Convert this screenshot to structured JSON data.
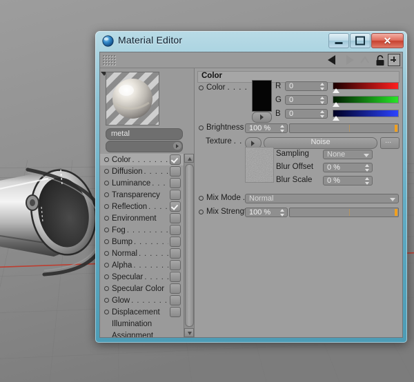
{
  "window": {
    "title": "Material Editor",
    "icon": "sphere-icon",
    "controls": {
      "minimize": "minimize-button",
      "maximize": "maximize-button",
      "close": "✕"
    }
  },
  "toolbar": {
    "grip": "drag-grip",
    "back": "back-arrow",
    "forward": "forward-arrow",
    "lock": "lock-icon",
    "add": "+"
  },
  "material": {
    "preview_label": "material-preview",
    "name": "metal",
    "selector_value": ""
  },
  "channels": [
    {
      "label": "Color",
      "dots": ". . . . . . . .",
      "checked": true,
      "selected": true
    },
    {
      "label": "Diffusion",
      "dots": ". . . . .",
      "checked": false,
      "selected": false
    },
    {
      "label": "Luminance",
      "dots": ". . .",
      "checked": false,
      "selected": false
    },
    {
      "label": "Transparency",
      "dots": "",
      "checked": false,
      "selected": false
    },
    {
      "label": "Reflection",
      "dots": ". . . .",
      "checked": true,
      "selected": false
    },
    {
      "label": "Environment",
      "dots": "",
      "checked": false,
      "selected": false
    },
    {
      "label": "Fog",
      "dots": ". . . . . . . .",
      "checked": false,
      "selected": false
    },
    {
      "label": "Bump",
      "dots": ". . . . . . .",
      "checked": false,
      "selected": false
    },
    {
      "label": "Normal",
      "dots": ". . . . . .",
      "checked": false,
      "selected": false
    },
    {
      "label": "Alpha",
      "dots": ". . . . . . .",
      "checked": false,
      "selected": false
    },
    {
      "label": "Specular",
      "dots": ". . . . .",
      "checked": false,
      "selected": false
    },
    {
      "label": "Specular Color",
      "dots": "",
      "checked": false,
      "selected": false
    },
    {
      "label": "Glow",
      "dots": ". . . . . . . .",
      "checked": false,
      "selected": false
    },
    {
      "label": "Displacement",
      "dots": "",
      "checked": false,
      "selected": false
    }
  ],
  "channels_plain": [
    {
      "label": "Illumination"
    },
    {
      "label": "Assignment"
    }
  ],
  "section": {
    "title": "Color",
    "color": {
      "label": "Color",
      "dots": ". . . .",
      "swatch_hex": "#050505",
      "r": {
        "label": "R",
        "value": "0"
      },
      "g": {
        "label": "G",
        "value": "0"
      },
      "b": {
        "label": "B",
        "value": "0"
      }
    },
    "brightness": {
      "label": "Brightness",
      "value": "100 %"
    },
    "texture": {
      "label": "Texture",
      "dots": ". . . .",
      "value": "Noise",
      "browse_label": "...",
      "sampling": {
        "label": "Sampling",
        "value": "None"
      },
      "blur_offset": {
        "label": "Blur Offset",
        "value": "0 %"
      },
      "blur_scale": {
        "label": "Blur Scale",
        "value": "0 %"
      }
    },
    "mix_mode": {
      "label": "Mix Mode",
      "dots": ". .",
      "value": "Normal"
    },
    "mix_strength": {
      "label": "Mix Strength",
      "value": "100 %"
    }
  },
  "viewport": {
    "description": "3d-scene-metal-cylinder",
    "grid_color": "#6f6f6f",
    "axis_color": "#c0392b"
  }
}
